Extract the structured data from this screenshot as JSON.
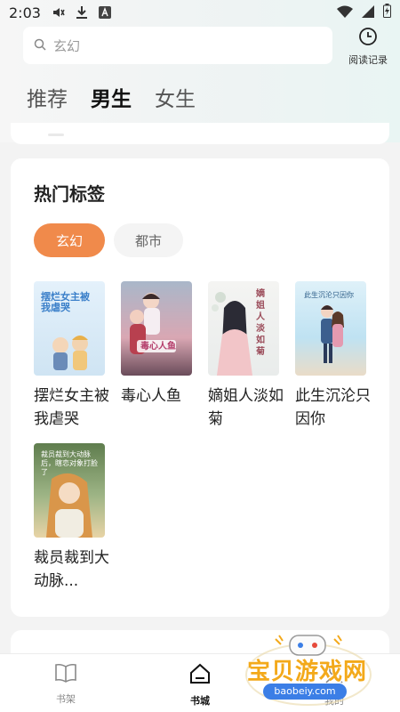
{
  "status_bar": {
    "time": "2:03"
  },
  "search": {
    "placeholder": "玄幻"
  },
  "reading_record": {
    "label": "阅读记录"
  },
  "gender_tabs": [
    {
      "label": "推荐"
    },
    {
      "label": "男生"
    },
    {
      "label": "女生"
    }
  ],
  "hot_tags": {
    "title": "热门标签",
    "tags": [
      {
        "label": "玄幻",
        "active": true
      },
      {
        "label": "都市",
        "active": false
      }
    ]
  },
  "books": [
    {
      "title": "摆烂女主被我虐哭",
      "cover_text": "摆烂女主被我虐哭",
      "cover_color": "#d7ebf7"
    },
    {
      "title": "毒心人鱼",
      "cover_text": "毒心人鱼",
      "cover_color": "#c9a9b6"
    },
    {
      "title": "嫡姐人淡如菊",
      "cover_text": "嫡姐人淡如菊",
      "cover_color": "#eef0ef"
    },
    {
      "title": "此生沉沦只因你",
      "cover_text": "此生沉沦只因你",
      "cover_color": "#bfe3f2"
    },
    {
      "title": "裁员裁到大动脉...",
      "cover_text": "裁员裁到大动脉后，瞎恋对象打脸了",
      "cover_color": "#8aa37a"
    }
  ],
  "bottom_nav": [
    {
      "label": "书架",
      "icon": "book-open-icon",
      "active": false
    },
    {
      "label": "书城",
      "icon": "home-icon",
      "active": true
    },
    {
      "label": "我的",
      "icon": "user-icon",
      "active": false
    }
  ],
  "watermark": {
    "text": "宝贝游戏网",
    "url": "baobeiy.com"
  },
  "colors": {
    "accent": "#f08a4b",
    "watermark": "#f3a91a"
  }
}
